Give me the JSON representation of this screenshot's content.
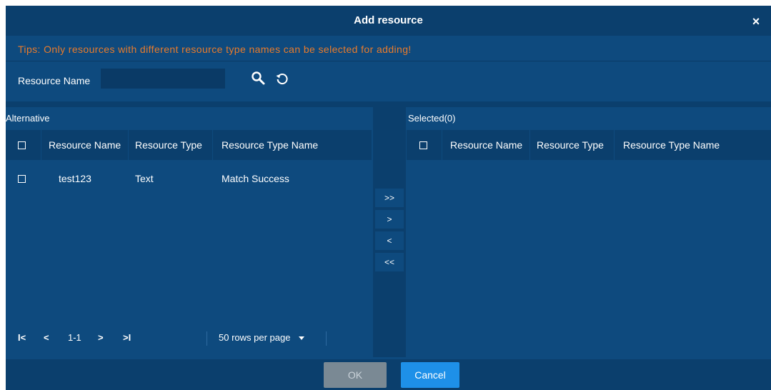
{
  "dialog": {
    "title": "Add resource",
    "close_symbol": "×",
    "tips": "Tips: Only resources with different resource type names can be selected for adding!"
  },
  "search": {
    "label": "Resource Name",
    "value": "",
    "placeholder": "",
    "search_icon": "search-icon",
    "refresh_icon": "refresh-icon"
  },
  "alternative": {
    "title": "Alternative",
    "columns": [
      "Resource Name",
      "Resource Type",
      "Resource Type Name"
    ],
    "rows": [
      {
        "name": "test123",
        "type": "Text",
        "type_name": "Match Success"
      }
    ]
  },
  "selected": {
    "title": "Selected(0)",
    "columns": [
      "Resource Name",
      "Resource Type",
      "Resource Type Name"
    ],
    "rows": []
  },
  "transfer": {
    "move_all_right": ">>",
    "move_right": ">",
    "move_left": "<",
    "move_all_left": "<<"
  },
  "pager": {
    "first": "I<",
    "prev": "<",
    "range": "1-1",
    "next": ">",
    "last": ">I",
    "rows_per_page": "50 rows per page"
  },
  "footer": {
    "ok_label": "OK",
    "cancel_label": "Cancel"
  },
  "colors": {
    "panel_bg": "#0e4a7e",
    "header_bg": "#0b3f6d",
    "tips_color": "#e87b2c",
    "cancel_bg": "#1e90e8",
    "ok_disabled_bg": "#7a8994"
  }
}
